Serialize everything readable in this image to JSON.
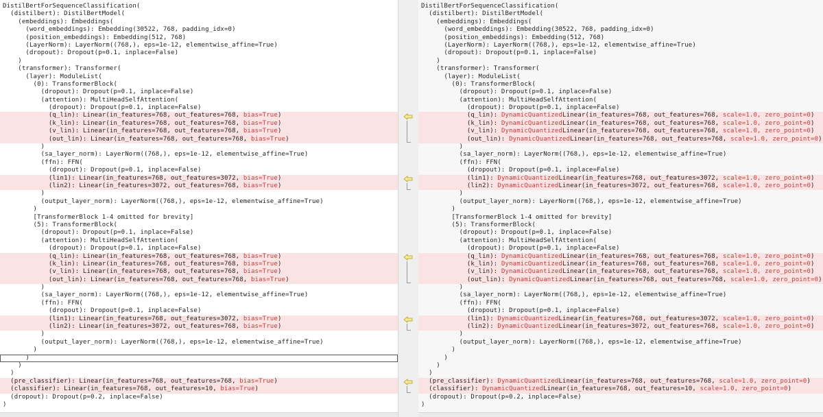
{
  "left": {
    "lines": [
      {
        "t": "DistilBertForSequenceClassification("
      },
      {
        "t": "  (distilbert): DistilBertModel("
      },
      {
        "t": "    (embeddings): Embeddings("
      },
      {
        "t": "      (word_embeddings): Embedding(30522, 768, padding_idx=0)"
      },
      {
        "t": "      (position_embeddings): Embedding(512, 768)"
      },
      {
        "t": "      (LayerNorm): LayerNorm((768,), eps=1e-12, elementwise_affine=True)"
      },
      {
        "t": "      (dropout): Dropout(p=0.1, inplace=False)"
      },
      {
        "t": "    )"
      },
      {
        "t": "    (transformer): Transformer("
      },
      {
        "t": "      (layer): ModuleList("
      },
      {
        "t": "        (0): TransformerBlock("
      },
      {
        "t": "          (dropout): Dropout(p=0.1, inplace=False)"
      },
      {
        "t": "          (attention): MultiHeadSelfAttention("
      },
      {
        "t": "            (dropout): Dropout(p=0.1, inplace=False)"
      },
      {
        "t": "            (q_lin): Linear(in_features=768, out_features=768, ",
        "r": "bias=True",
        "s": ")",
        "c": true
      },
      {
        "t": "            (k_lin): Linear(in_features=768, out_features=768, ",
        "r": "bias=True",
        "s": ")",
        "c": true
      },
      {
        "t": "            (v_lin): Linear(in_features=768, out_features=768, ",
        "r": "bias=True",
        "s": ")",
        "c": true
      },
      {
        "t": "            (out_lin): Linear(in_features=768, out_features=768, ",
        "r": "bias=True",
        "s": ")",
        "c": true
      },
      {
        "t": "          )"
      },
      {
        "t": "          (sa_layer_norm): LayerNorm((768,), eps=1e-12, elementwise_affine=True)"
      },
      {
        "t": "          (ffn): FFN("
      },
      {
        "t": "            (dropout): Dropout(p=0.1, inplace=False)"
      },
      {
        "t": "            (lin1): Linear(in_features=768, out_features=3072, ",
        "r": "bias=True",
        "s": ")",
        "c": true
      },
      {
        "t": "            (lin2): Linear(in_features=3072, out_features=768, ",
        "r": "bias=True",
        "s": ")",
        "c": true
      },
      {
        "t": "          )"
      },
      {
        "t": "          (output_layer_norm): LayerNorm((768,), eps=1e-12, elementwise_affine=True)"
      },
      {
        "t": "        )"
      },
      {
        "t": "        [TransformerBlock 1-4 omitted for brevity]"
      },
      {
        "t": "        (5): TransformerBlock("
      },
      {
        "t": "          (dropout): Dropout(p=0.1, inplace=False)"
      },
      {
        "t": "          (attention): MultiHeadSelfAttention("
      },
      {
        "t": "            (dropout): Dropout(p=0.1, inplace=False)"
      },
      {
        "t": "            (q_lin): Linear(in_features=768, out_features=768, ",
        "r": "bias=True",
        "s": ")",
        "c": true
      },
      {
        "t": "            (k_lin): Linear(in_features=768, out_features=768, ",
        "r": "bias=True",
        "s": ")",
        "c": true
      },
      {
        "t": "            (v_lin): Linear(in_features=768, out_features=768, ",
        "r": "bias=True",
        "s": ")",
        "c": true
      },
      {
        "t": "            (out_lin): Linear(in_features=768, out_features=768, ",
        "r": "bias=True",
        "s": ")",
        "c": true
      },
      {
        "t": "          )"
      },
      {
        "t": "          (sa_layer_norm): LayerNorm((768,), eps=1e-12, elementwise_affine=True)"
      },
      {
        "t": "          (ffn): FFN("
      },
      {
        "t": "            (dropout): Dropout(p=0.1, inplace=False)"
      },
      {
        "t": "            (lin1): Linear(in_features=768, out_features=3072, ",
        "r": "bias=True",
        "s": ")",
        "c": true
      },
      {
        "t": "            (lin2): Linear(in_features=3072, out_features=768, ",
        "r": "bias=True",
        "s": ")",
        "c": true
      },
      {
        "t": "          )"
      },
      {
        "t": "          (output_layer_norm): LayerNorm((768,), eps=1e-12, elementwise_affine=True)"
      },
      {
        "t": "        )"
      },
      {
        "t": "      )",
        "cursor": true
      },
      {
        "t": "    )"
      },
      {
        "t": "  )"
      },
      {
        "t": "  (pre_classifier): Linear(in_features=768, out_features=768, ",
        "r": "bias=True",
        "s": ")",
        "c": true
      },
      {
        "t": "  (classifier): Linear(in_features=768, out_features=10, ",
        "r": "bias=True",
        "s": ")",
        "c": true
      },
      {
        "t": "  (dropout): Dropout(p=0.2, inplace=False)"
      },
      {
        "t": ")"
      }
    ]
  },
  "right": {
    "lines": [
      {
        "t": "DistilBertForSequenceClassification("
      },
      {
        "t": "  (distilbert): DistilBertModel("
      },
      {
        "t": "    (embeddings): Embeddings("
      },
      {
        "t": "      (word_embeddings): Embedding(30522, 768, padding_idx=0)"
      },
      {
        "t": "      (position_embeddings): Embedding(512, 768)"
      },
      {
        "t": "      (LayerNorm): LayerNorm((768,), eps=1e-12, elementwise_affine=True)"
      },
      {
        "t": "      (dropout): Dropout(p=0.1, inplace=False)"
      },
      {
        "t": "    )"
      },
      {
        "t": "    (transformer): Transformer("
      },
      {
        "t": "      (layer): ModuleList("
      },
      {
        "t": "        (0): TransformerBlock("
      },
      {
        "t": "          (dropout): Dropout(p=0.1, inplace=False)"
      },
      {
        "t": "          (attention): MultiHeadSelfAttention("
      },
      {
        "t": "            (dropout): Dropout(p=0.1, inplace=False)"
      },
      {
        "t": "            (q_lin): ",
        "r": "DynamicQuantized",
        "s": "Linear(in_features=768, out_features=768, ",
        "r2": "scale=1.0, zero_point=0",
        "s2": ")",
        "c": true
      },
      {
        "t": "            (k_lin): ",
        "r": "DynamicQuantized",
        "s": "Linear(in_features=768, out_features=768, ",
        "r2": "scale=1.0, zero_point=0",
        "s2": ")",
        "c": true
      },
      {
        "t": "            (v_lin): ",
        "r": "DynamicQuantized",
        "s": "Linear(in_features=768, out_features=768, ",
        "r2": "scale=1.0, zero_point=0",
        "s2": ")",
        "c": true
      },
      {
        "t": "            (out_lin): ",
        "r": "DynamicQuantized",
        "s": "Linear(in_features=768, out_features=768, ",
        "r2": "scale=1.0, zero_point=0",
        "s2": ")",
        "c": true
      },
      {
        "t": "          )"
      },
      {
        "t": "          (sa_layer_norm): LayerNorm((768,), eps=1e-12, elementwise_affine=True)"
      },
      {
        "t": "          (ffn): FFN("
      },
      {
        "t": "            (dropout): Dropout(p=0.1, inplace=False)"
      },
      {
        "t": "            (lin1): ",
        "r": "DynamicQuantized",
        "s": "Linear(in_features=768, out_features=3072, ",
        "r2": "scale=1.0, zero_point=0",
        "s2": ")",
        "c": true
      },
      {
        "t": "            (lin2): ",
        "r": "DynamicQuantized",
        "s": "Linear(in_features=3072, out_features=768, ",
        "r2": "scale=1.0, zero_point=0",
        "s2": ")",
        "c": true
      },
      {
        "t": "          )"
      },
      {
        "t": "          (output_layer_norm): LayerNorm((768,), eps=1e-12, elementwise_affine=True)"
      },
      {
        "t": "        )"
      },
      {
        "t": "        [TransformerBlock 1-4 omitted for brevity]"
      },
      {
        "t": "        (5): TransformerBlock("
      },
      {
        "t": "          (dropout): Dropout(p=0.1, inplace=False)"
      },
      {
        "t": "          (attention): MultiHeadSelfAttention("
      },
      {
        "t": "            (dropout): Dropout(p=0.1, inplace=False)"
      },
      {
        "t": "            (q_lin): ",
        "r": "DynamicQuantized",
        "s": "Linear(in_features=768, out_features=768, ",
        "r2": "scale=1.0, zero_point=0",
        "s2": ")",
        "c": true
      },
      {
        "t": "            (k_lin): ",
        "r": "DynamicQuantized",
        "s": "Linear(in_features=768, out_features=768, ",
        "r2": "scale=1.0, zero_point=0",
        "s2": ")",
        "c": true
      },
      {
        "t": "            (v_lin): ",
        "r": "DynamicQuantized",
        "s": "Linear(in_features=768, out_features=768, ",
        "r2": "scale=1.0, zero_point=0",
        "s2": ")",
        "c": true
      },
      {
        "t": "            (out_lin): ",
        "r": "DynamicQuantized",
        "s": "Linear(in_features=768, out_features=768, ",
        "r2": "scale=1.0, zero_point=0",
        "s2": ")",
        "c": true
      },
      {
        "t": "          )"
      },
      {
        "t": "          (sa_layer_norm): LayerNorm((768,), eps=1e-12, elementwise_affine=True)"
      },
      {
        "t": "          (ffn): FFN("
      },
      {
        "t": "            (dropout): Dropout(p=0.1, inplace=False)"
      },
      {
        "t": "            (lin1): ",
        "r": "DynamicQuantized",
        "s": "Linear(in_features=768, out_features=3072, ",
        "r2": "scale=1.0, zero_point=0",
        "s2": ")",
        "c": true
      },
      {
        "t": "            (lin2): ",
        "r": "DynamicQuantized",
        "s": "Linear(in_features=3072, out_features=768, ",
        "r2": "scale=1.0, zero_point=0",
        "s2": ")",
        "c": true
      },
      {
        "t": "          )"
      },
      {
        "t": "          (output_layer_norm): LayerNorm((768,), eps=1e-12, elementwise_affine=True)"
      },
      {
        "t": "        )"
      },
      {
        "t": "      )"
      },
      {
        "t": "    )"
      },
      {
        "t": "  )"
      },
      {
        "t": "  (pre_classifier): ",
        "r": "DynamicQuantized",
        "s": "Linear(in_features=768, out_features=768, ",
        "r2": "scale=1.0, zero_point=0",
        "s2": ")",
        "c": true
      },
      {
        "t": "  (classifier): ",
        "r": "DynamicQuantized",
        "s": "Linear(in_features=768, out_features=10, ",
        "r2": "scale=1.0, zero_point=0",
        "s2": ")",
        "c": true
      },
      {
        "t": "  (dropout): Dropout(p=0.2, inplace=False)"
      },
      {
        "t": ")"
      }
    ]
  },
  "diff_blocks": [
    {
      "start": 14,
      "end": 17
    },
    {
      "start": 22,
      "end": 23
    },
    {
      "start": 32,
      "end": 35
    },
    {
      "start": 40,
      "end": 41
    },
    {
      "start": 48,
      "end": 49
    }
  ],
  "colors": {
    "changed_bg": "#fbe3e3",
    "changed_text": "#c63b3b",
    "arrow_fill": "#f4ec9c",
    "arrow_stroke": "#b79b1c"
  }
}
